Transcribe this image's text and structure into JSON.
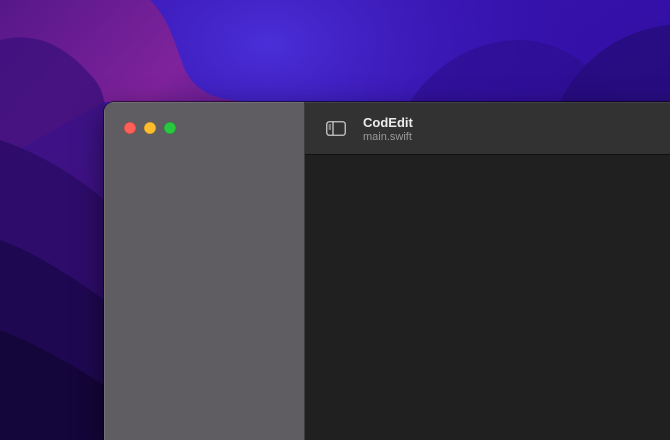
{
  "window": {
    "title": "CodEdit",
    "subtitle": "main.swift"
  },
  "traffic_lights": {
    "close": "#fe5f57",
    "minimize": "#febc2e",
    "zoom": "#28c840"
  },
  "toolbar": {
    "sidebar_toggle_icon": "sidebar-left-icon"
  },
  "colors": {
    "sidebar_bg": "#5f5d62",
    "toolbar_bg": "#323232",
    "editor_bg": "#202020",
    "wallpaper_primary": "#3b12b0",
    "wallpaper_accent": "#7a1f8f"
  }
}
